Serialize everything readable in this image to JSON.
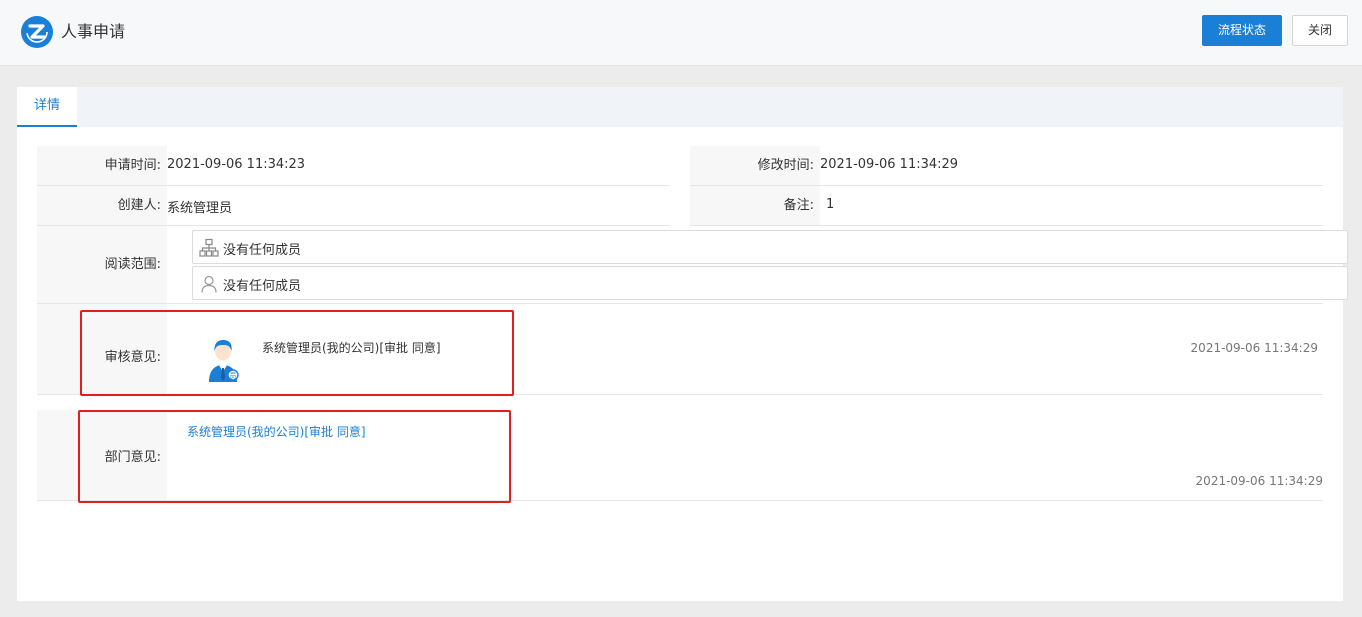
{
  "app": {
    "title": "人事申请"
  },
  "toolbar": {
    "flow_status_label": "流程状态",
    "close_label": "关闭"
  },
  "tabs": [
    {
      "label": "详情",
      "active": true
    }
  ],
  "fields": {
    "apply_time": {
      "label": "申请时间:",
      "value": "2021-09-06 11:34:23"
    },
    "modify_time": {
      "label": "修改时间:",
      "value": "2021-09-06 11:34:29"
    },
    "creator": {
      "label": "创建人:",
      "value": "系统管理员"
    },
    "remark": {
      "label": "备注:",
      "value": "1"
    },
    "read_scope": {
      "label": "阅读范围:",
      "departments": "没有任何成员",
      "users": "没有任何成员"
    }
  },
  "review": {
    "label": "审核意见:",
    "entry": "系统管理员(我的公司)[审批 同意]",
    "time": "2021-09-06 11:34:29"
  },
  "dept_opinion": {
    "label": "部门意见:",
    "entry": "系统管理员(我的公司)[审批 同意]",
    "time": "2021-09-06 11:34:29"
  },
  "colors": {
    "accent": "#1a7fd6",
    "highlight": "#e02020",
    "label_bg": "#f7f7f7"
  },
  "icons": {
    "logo": "brand-logo-icon",
    "org": "org-chart-icon",
    "user": "user-icon",
    "avatar": "user-avatar-icon"
  }
}
